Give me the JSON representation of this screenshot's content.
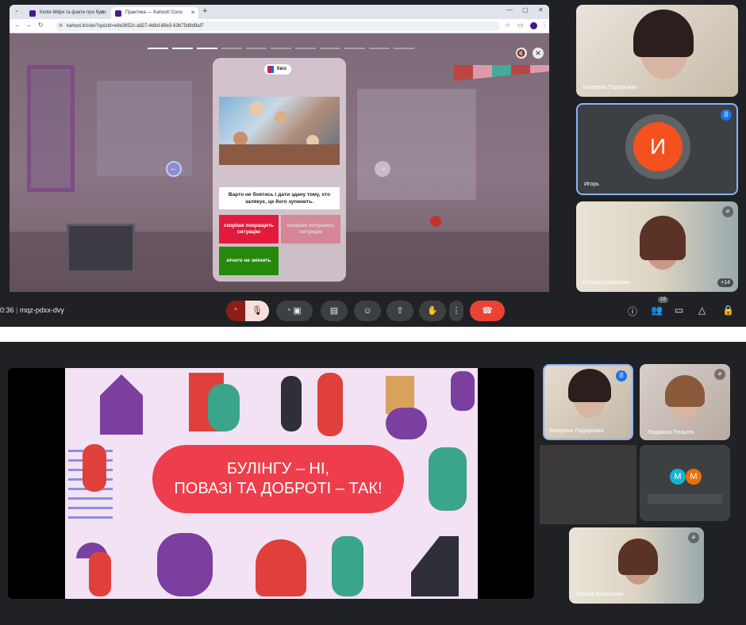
{
  "browser": {
    "tabs": [
      {
        "label": "Копія Міфи та факти про було"
      },
      {
        "label": "Практика — Kahoot! Соло"
      }
    ],
    "url": "kahoot.it/solo/?quizId=e8e3652c-a827-4d8d-89e3-63b75d9d9af7"
  },
  "quiz": {
    "badge": "Квіз",
    "question": "Варто не боятись і дати здачу тому, хто залякує, це його зупинить.",
    "answers": [
      {
        "text": "скоріше покращить ситуацію",
        "color": "#e21b3c"
      },
      {
        "text": "скоріше погіршить ситуацію",
        "color": "#e21b3c"
      },
      {
        "text": "нічого не змінить",
        "color": "#26890c"
      }
    ],
    "progress_total": 11,
    "progress_done": 3
  },
  "meet_top": {
    "participants": [
      {
        "name": "Катерина Подорожко"
      },
      {
        "name": "Игорь",
        "initial": "И"
      },
      {
        "name": "Оксана Шапошник",
        "extra": "+14"
      }
    ],
    "time": "0:36",
    "code": "mqz-pdxx-dvy",
    "people_count": "18"
  },
  "meet_bottom": {
    "slide_title_line1": "БУЛІНГУ – НІ,",
    "slide_title_line2": "ПОВАЗІ ТА ДОБРОТІ – ТАК!",
    "participants": [
      {
        "name": "Катерина Подорожко"
      },
      {
        "name": "Людмила Пельтек"
      },
      {
        "name": "Оксана Шапошник"
      }
    ],
    "avatars": [
      "М",
      "М"
    ]
  }
}
